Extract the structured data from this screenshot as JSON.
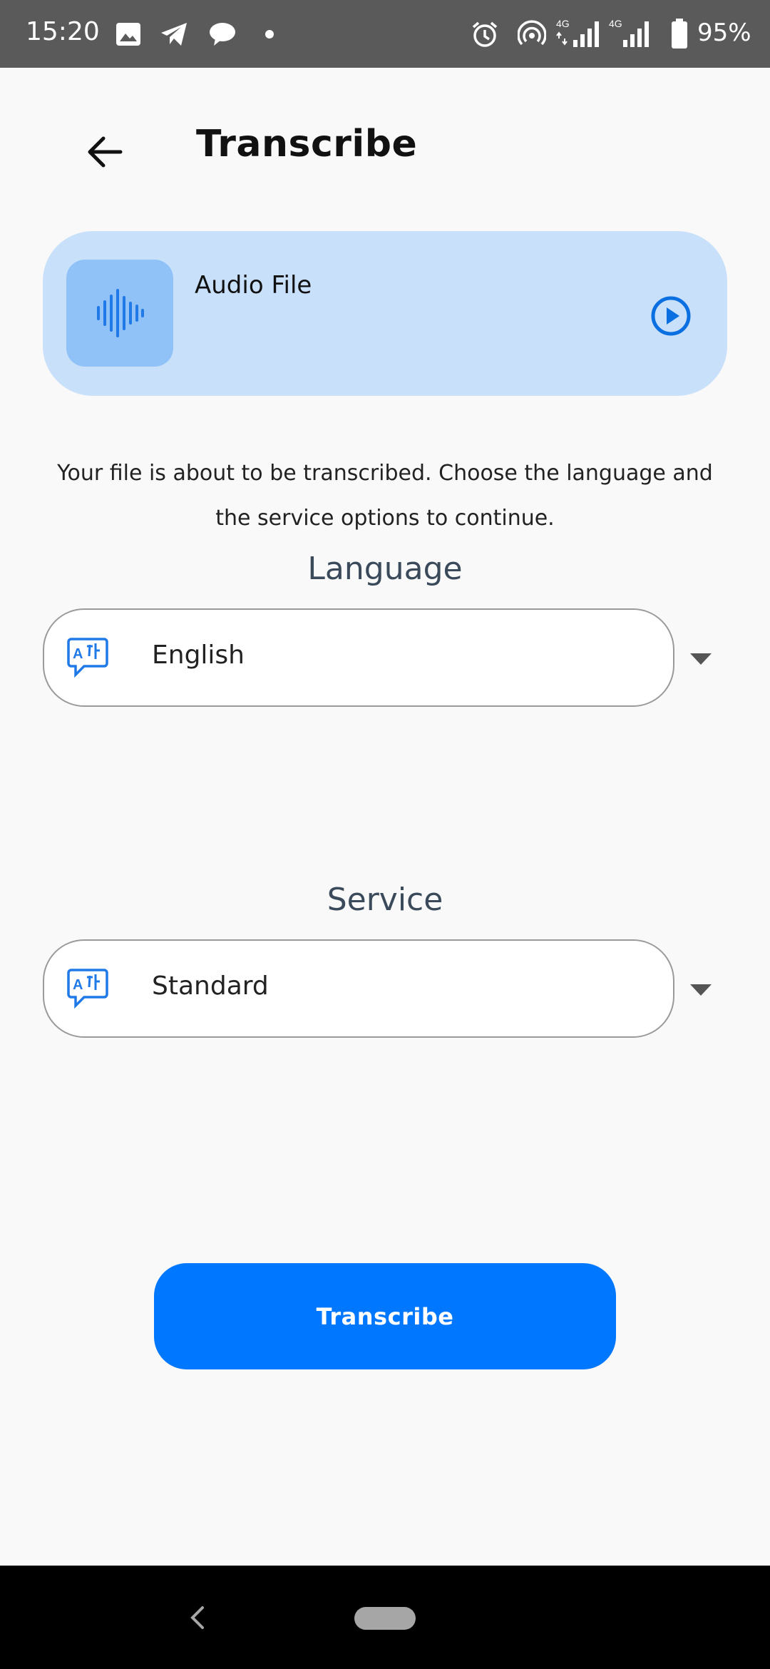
{
  "status_bar": {
    "time": "15:20",
    "battery": "95%",
    "icons": [
      "image-icon",
      "telegram-icon",
      "chat-bubble-icon",
      "dot-icon",
      "alarm-icon",
      "hotspot-icon",
      "signal-4g-icon",
      "signal-4g-icon-2",
      "battery-icon"
    ]
  },
  "header": {
    "title": "Transcribe",
    "back_icon": "arrow-left-icon"
  },
  "audio_card": {
    "title": "Audio File",
    "thumb_icon": "waveform-icon",
    "play_icon": "play-circle-icon"
  },
  "intro": {
    "line1": "Your file is about to be transcribed. Choose the language and",
    "line2": "the service options to continue."
  },
  "language": {
    "label": "Language",
    "value": "English",
    "icon": "translate-icon"
  },
  "service": {
    "label": "Service",
    "value": "Standard",
    "icon": "translate-icon"
  },
  "primary_button": {
    "label": "Transcribe"
  },
  "colors": {
    "accent": "#0077ff",
    "card_bg": "#c9e0fb",
    "thumb_bg": "#90c2f8",
    "status_bar": "#5a5a5a",
    "page_bg": "#f9f9f9"
  }
}
